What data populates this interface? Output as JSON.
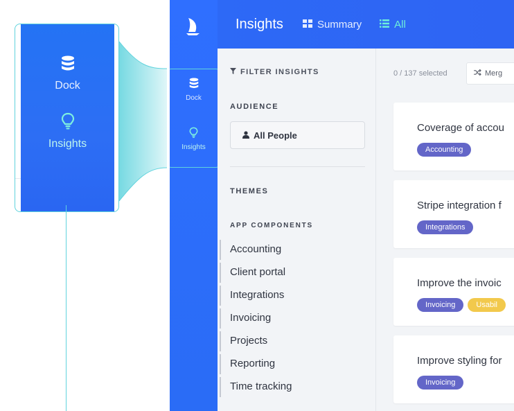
{
  "callout": {
    "dock_label": "Dock",
    "insights_label": "Insights"
  },
  "rail": {
    "items": [
      {
        "label": "Dock",
        "icon": "database-icon"
      },
      {
        "label": "Insights",
        "icon": "lightbulb-icon"
      }
    ]
  },
  "topbar": {
    "title": "Insights",
    "tabs": [
      {
        "label": "Summary",
        "icon": "grid-icon"
      },
      {
        "label": "All",
        "icon": "list-icon",
        "active": true
      }
    ]
  },
  "filter": {
    "heading": "FILTER INSIGHTS",
    "audience_title": "AUDIENCE",
    "audience_button": "All People",
    "themes_title": "THEMES",
    "app_components_title": "APP COMPONENTS",
    "components": [
      "Accounting",
      "Client portal",
      "Integrations",
      "Invoicing",
      "Projects",
      "Reporting",
      "Time tracking"
    ]
  },
  "main": {
    "selection": "0 / 137 selected",
    "merge_label": "Merg",
    "cards": [
      {
        "title": "Coverage of accou",
        "tags": [
          {
            "label": "Accounting",
            "color": "#6366c8"
          }
        ]
      },
      {
        "title": "Stripe integration f",
        "tags": [
          {
            "label": "Integrations",
            "color": "#6366c8"
          }
        ]
      },
      {
        "title": "Improve the invoic",
        "tags": [
          {
            "label": "Invoicing",
            "color": "#6366c8"
          },
          {
            "label": "Usabil",
            "color": "#f2c94c"
          }
        ]
      },
      {
        "title": "Improve styling for",
        "tags": [
          {
            "label": "Invoicing",
            "color": "#6366c8"
          }
        ]
      }
    ]
  },
  "colors": {
    "brand_blue": "#2d6ef4",
    "accent_teal": "#5fd3dd",
    "tag_purple": "#6366c8",
    "tag_yellow": "#f2c94c"
  }
}
